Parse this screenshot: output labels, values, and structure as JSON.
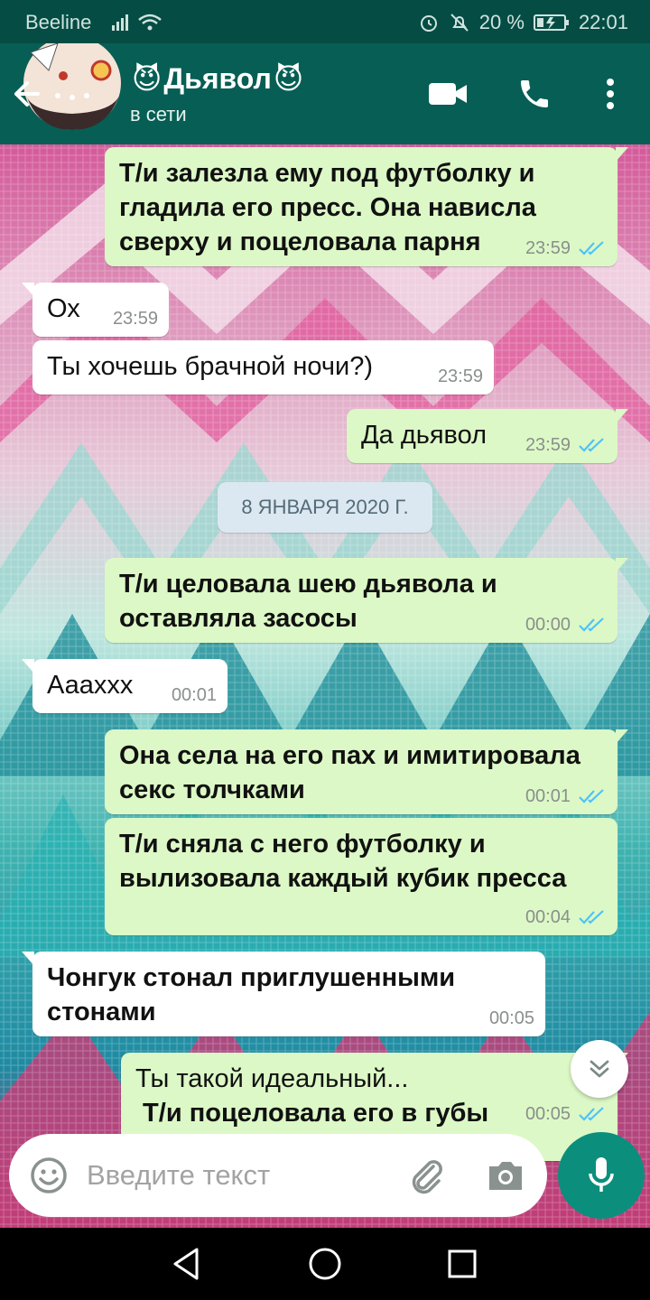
{
  "colors": {
    "header": "#075e54",
    "statusbar": "#054d44",
    "out_bubble": "#dcf8c6",
    "in_bubble": "#ffffff",
    "tick": "#4fc3f7",
    "mic": "#0b8f7c"
  },
  "status_bar": {
    "carrier": "Beeline",
    "battery": "20 %",
    "time": "22:01"
  },
  "header": {
    "name": "Дьявол",
    "name_emoji": "😈",
    "status": "в сети"
  },
  "messages": [
    {
      "dir": "out",
      "lines": [
        "Т/и залезла ему под футболку и",
        "гладила его пресс. Она нависла",
        "сверху и поцеловала парня"
      ],
      "bold": true,
      "time": "23:59"
    },
    {
      "dir": "in",
      "lines": [
        "Ох"
      ],
      "bold": false,
      "time": "23:59"
    },
    {
      "dir": "in",
      "lines": [
        "Ты хочешь брачной ночи?)"
      ],
      "bold": false,
      "time": "23:59"
    },
    {
      "dir": "out",
      "lines": [
        "Да дьявол"
      ],
      "bold": false,
      "time": "23:59"
    },
    {
      "dir": "out",
      "lines": [
        "Т/и целовала шею дьявола и",
        "оставляла засосы"
      ],
      "bold": true,
      "time": "00:00"
    },
    {
      "dir": "in",
      "lines": [
        "Аааххх"
      ],
      "bold": false,
      "time": "00:01"
    },
    {
      "dir": "out",
      "lines": [
        "Она села на его пах и имитировала",
        "секс толчками"
      ],
      "bold": true,
      "time": "00:01"
    },
    {
      "dir": "out",
      "lines": [
        "Т/и сняла с него футболку и",
        "вылизовала каждый кубик пресса"
      ],
      "bold": true,
      "time": "00:04"
    },
    {
      "dir": "in",
      "lines": [
        "Чонгук стонал приглушенными",
        "стонами"
      ],
      "bold": true,
      "time": "00:05"
    },
    {
      "dir": "out",
      "lines": [
        "Ты такой идеальный...",
        " Т/и поцеловала его в губы"
      ],
      "bold": false,
      "time": "00:05"
    }
  ],
  "date_separator": "8 ЯНВАРЯ 2020 Г.",
  "input": {
    "placeholder": "Введите текст"
  }
}
